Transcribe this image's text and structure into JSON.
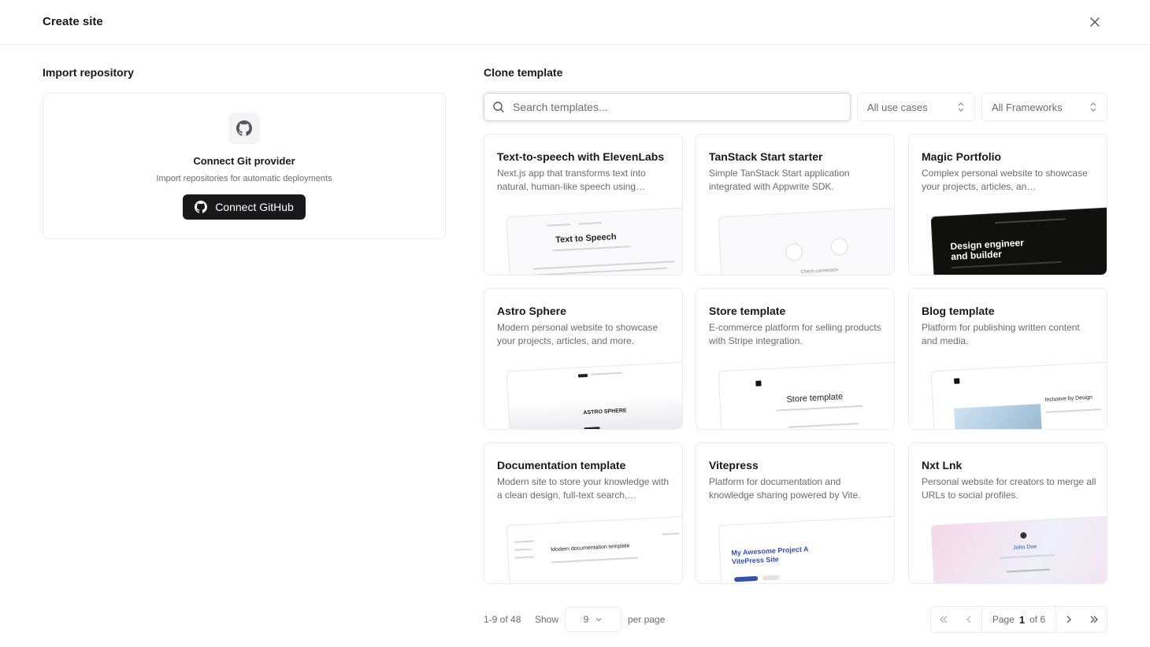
{
  "header": {
    "title": "Create site"
  },
  "import": {
    "section_title": "Import repository",
    "connect_title": "Connect Git provider",
    "connect_subtitle": "Import repositories for automatic deployments",
    "button_label": "Connect GitHub"
  },
  "clone": {
    "section_title": "Clone template",
    "search_placeholder": "Search templates...",
    "use_case_filter": "All use cases",
    "framework_filter": "All Frameworks"
  },
  "templates": [
    {
      "title": "Text-to-speech with ElevenLabs",
      "description": "Next.js app that transforms text into natural, human-like speech using…",
      "preview_heading": "Text to Speech"
    },
    {
      "title": "TanStack Start starter",
      "description": "Simple TanStack Start application integrated with Appwrite SDK.",
      "preview_heading": "Check connection"
    },
    {
      "title": "Magic Portfolio",
      "description": "Complex personal website to showcase your projects, articles, an…",
      "preview_heading": "Design engineer and builder"
    },
    {
      "title": "Astro Sphere",
      "description": "Modern personal website to showcase your projects, articles, and more.",
      "preview_heading": "ASTRO SPHERE"
    },
    {
      "title": "Store template",
      "description": "E-commerce platform for selling products with Stripe integration.",
      "preview_heading": "Store template"
    },
    {
      "title": "Blog template",
      "description": "Platform for publishing written content and media.",
      "preview_heading": "Inclusive by Design"
    },
    {
      "title": "Documentation template",
      "description": "Modern site to store your knowledge with a clean design, full-text search,…",
      "preview_heading": "Modern documentation template"
    },
    {
      "title": "Vitepress",
      "description": "Platform for documentation and knowledge sharing powered by Vite.",
      "preview_heading": "My Awesome Project A VitePress Site"
    },
    {
      "title": "Nxt Lnk",
      "description": "Personal website for creators to merge all URLs to social profiles.",
      "preview_heading": "John Doe"
    }
  ],
  "pagination": {
    "range_label": "1-9 of 48",
    "show_label": "Show",
    "per_page_value": "9",
    "per_page_label": "per page",
    "page_label": "Page",
    "current_page": "1",
    "of_label": "of 6"
  }
}
